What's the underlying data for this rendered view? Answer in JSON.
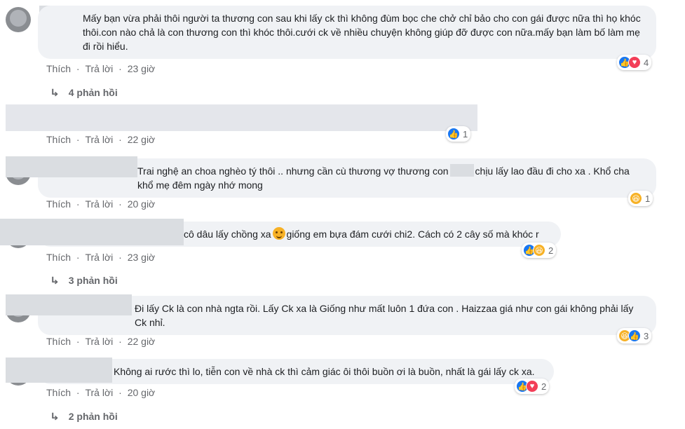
{
  "labels": {
    "like": "Thích",
    "reply": "Trả lời",
    "dot": "·"
  },
  "comments": [
    {
      "text": "Mấy bạn vừa phải thôi người ta thương con sau khi lấy ck thì không đùm bọc che chở chỉ bảo cho con gái được nữa thì họ khóc thôi.con nào chả là con thương con thì khóc thôi.cưới ck về nhiều chuyện không giúp đỡ được con nữa.mấy bạn làm bố làm mẹ đi rồi hiểu.",
      "time": "23 giờ",
      "reactions": [
        "like",
        "love"
      ],
      "reaction_count": "4",
      "replies": "4 phản hồi"
    },
    {
      "text": "",
      "time": "22 giờ",
      "reactions": [
        "like"
      ],
      "reaction_count": "1"
    },
    {
      "text": "Trai nghệ an choa nghèo tý thôi .. nhưng cần cù thương vợ thương con",
      "text_after": "chịu lấy lao đầu đi cho xa . Khổ cha khổ mẹ đêm ngày nhớ mong",
      "time": "20 giờ",
      "reactions": [
        "haha"
      ],
      "reaction_count": "1"
    },
    {
      "text": "cô dâu lấy chồng xa",
      "text_after": "giống em bựa đám cưới chi2. Cách có 2 cây số mà khóc r",
      "time": "23 giờ",
      "reactions": [
        "like",
        "haha"
      ],
      "reaction_count": "2",
      "replies": "3 phản hồi"
    },
    {
      "text": "Đi lấy Ck là con nhà ngta rồi. Lấy Ck xa là Giống như mất luôn 1 đứa con . Haizzaa giá như con gái không phải lấy Ck nhỉ.",
      "time": "22 giờ",
      "reactions": [
        "haha",
        "like"
      ],
      "reaction_count": "3"
    },
    {
      "text": "Không ai rước thì lo, tiễn con về nhà ck thì cảm giác ôi thôi buồn ơi là buồn, nhất là gái lấy ck xa.",
      "time": "20 giờ",
      "reactions": [
        "like",
        "love"
      ],
      "reaction_count": "2",
      "replies": "2 phản hồi"
    }
  ],
  "icons": {
    "like": "like-icon",
    "love": "love-icon",
    "haha": "haha-icon",
    "reply_arrow": "reply-arrow-icon"
  },
  "colors": {
    "bubble": "#f0f2f5",
    "meta": "#65676b",
    "like": "#1877f2",
    "love": "#f33e58",
    "haha": "#f7b125"
  }
}
